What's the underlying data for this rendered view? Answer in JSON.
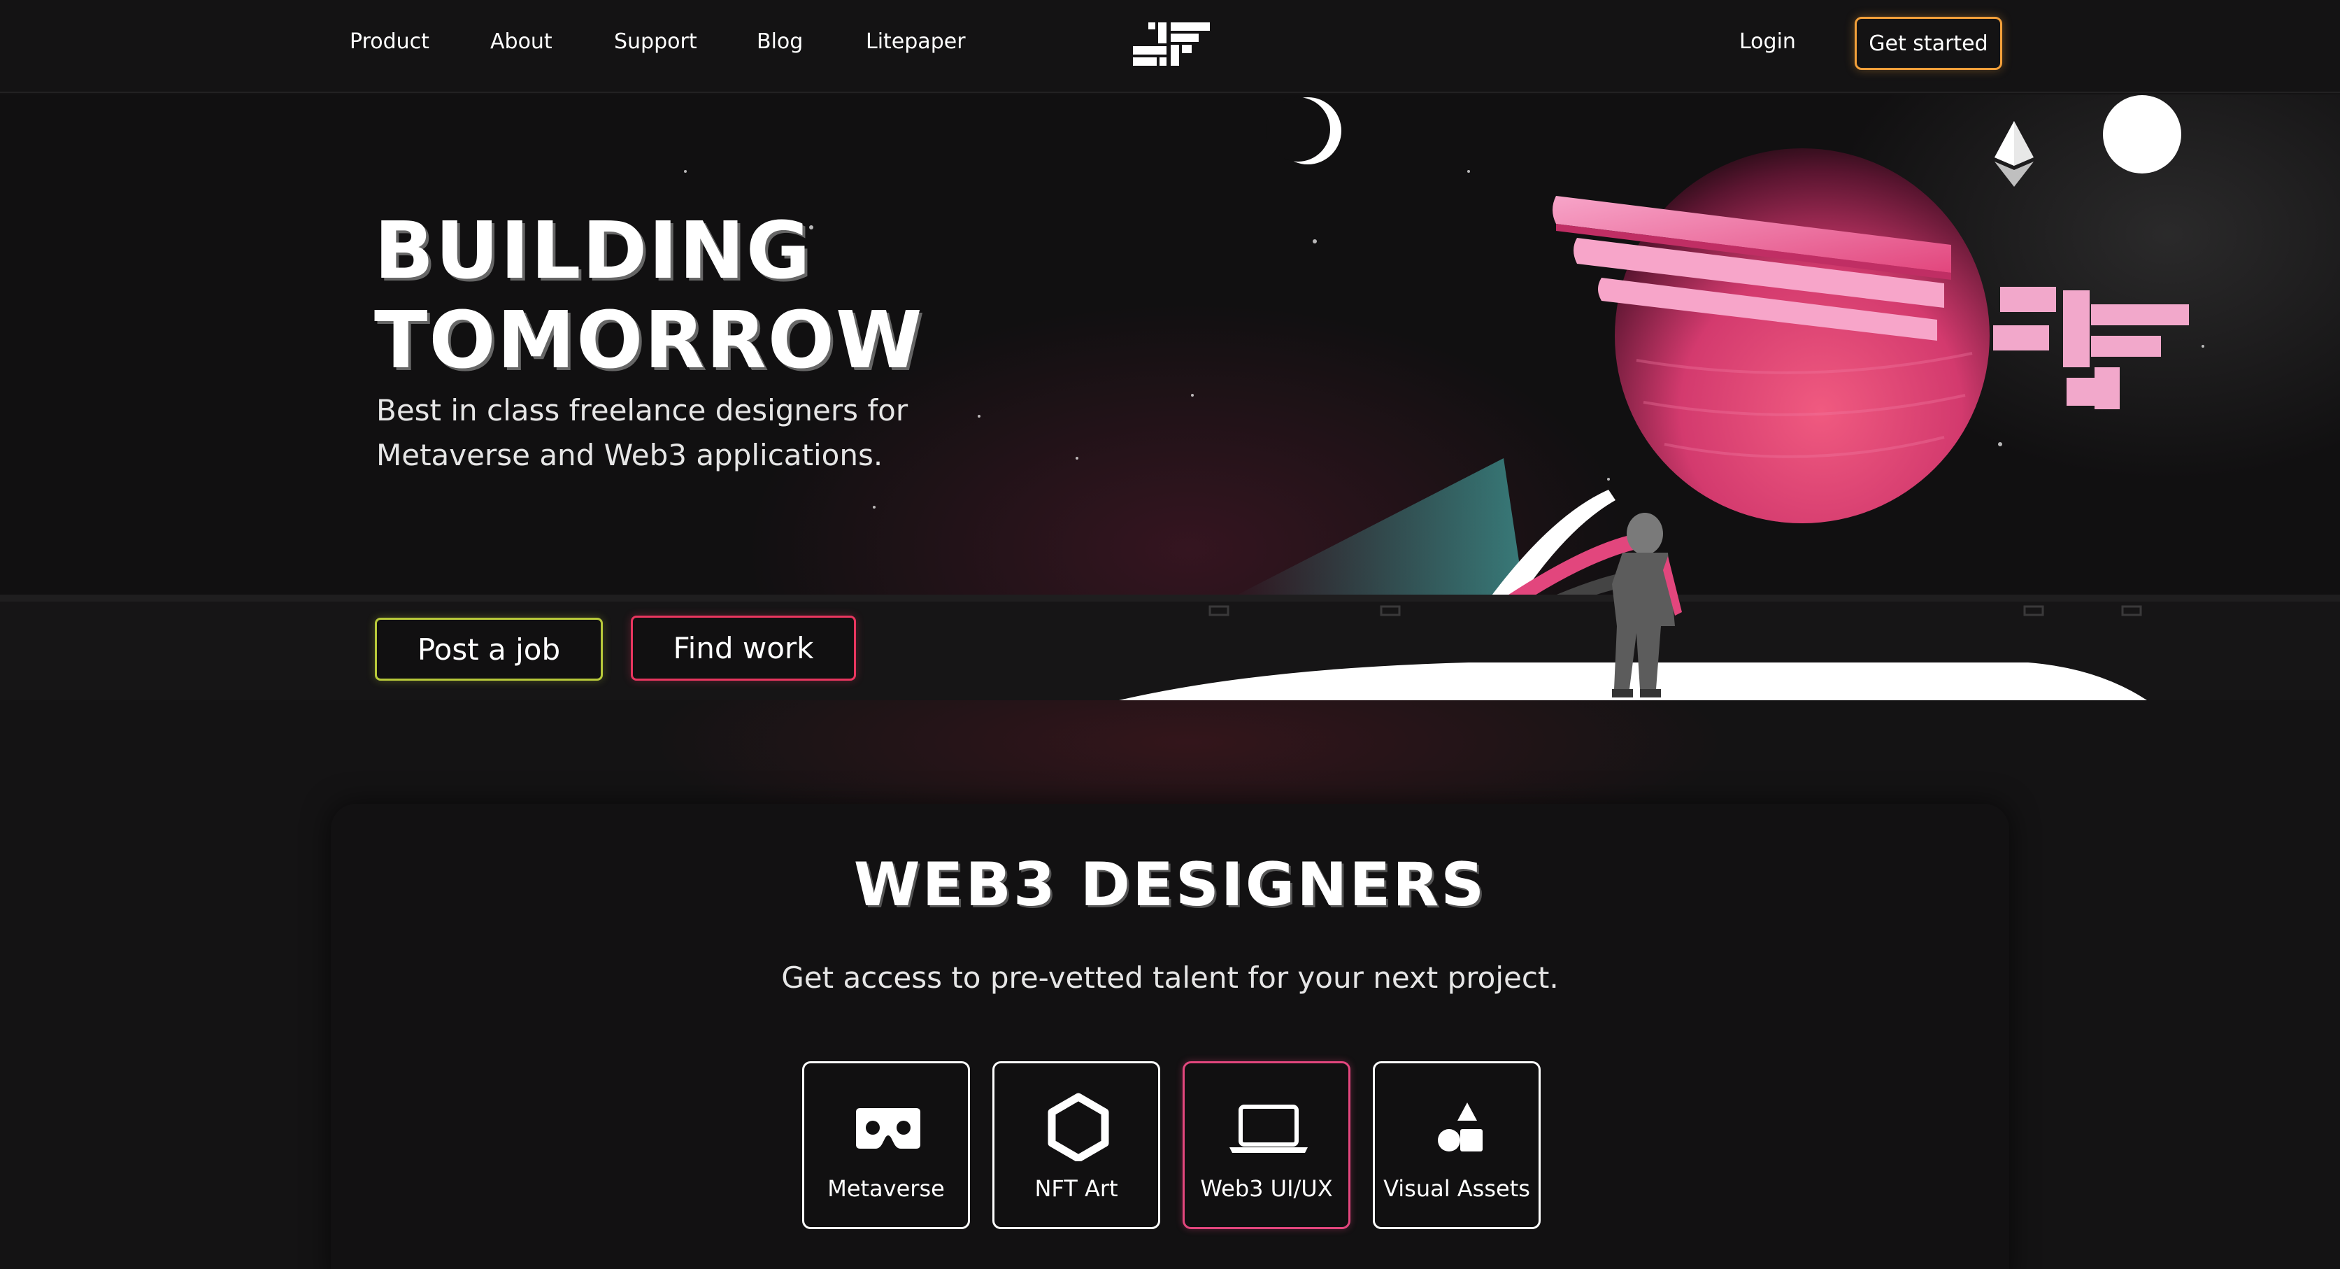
{
  "nav": {
    "links": [
      "Product",
      "About",
      "Support",
      "Blog",
      "Litepaper"
    ],
    "login": "Login",
    "get_started": "Get started"
  },
  "hero": {
    "title_line1": "BUILDING",
    "title_line2": "TOMORROW",
    "subtitle_line1": "Best in class freelance designers for",
    "subtitle_line2": "Metaverse and Web3 applications.",
    "post_job": "Post a job",
    "find_work": "Find work"
  },
  "designers": {
    "title": "WEB3 DESIGNERS",
    "subtitle": "Get access to pre-vetted talent for your next project.",
    "categories": [
      {
        "label": "Metaverse",
        "icon": "vr-headset-icon"
      },
      {
        "label": "NFT Art",
        "icon": "hexagon-icon"
      },
      {
        "label": "Web3 UI/UX",
        "icon": "laptop-icon"
      },
      {
        "label": "Visual Assets",
        "icon": "shapes-icon"
      }
    ],
    "active_category": "Web3 UI/UX"
  },
  "colors": {
    "background": "#141314",
    "accent_orange": "#f3a03a",
    "accent_lime": "#b8c93a",
    "accent_pink": "#e8365f",
    "planet_pink": "#e2467d"
  }
}
